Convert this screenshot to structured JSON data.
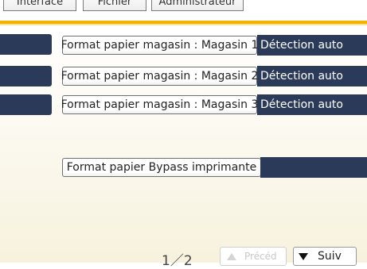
{
  "tabs": [
    {
      "label": "Interface"
    },
    {
      "label": "Fichier"
    },
    {
      "label": "Administrateur"
    }
  ],
  "rows": [
    {
      "label": "Format papier magasin : Magasin 1",
      "value": "Détection auto"
    },
    {
      "label": "Format papier magasin : Magasin 2",
      "value": "Détection auto"
    },
    {
      "label": "Format papier magasin : Magasin 3",
      "value": "Détection auto"
    },
    {
      "label": "Format papier Bypass imprimante",
      "value": ""
    }
  ],
  "pagination": {
    "indicator": "1／2",
    "prev_label": "Précéd",
    "next_label": "Suiv"
  },
  "colors": {
    "accent": "#f6b000",
    "navy": "#2a3a58"
  }
}
